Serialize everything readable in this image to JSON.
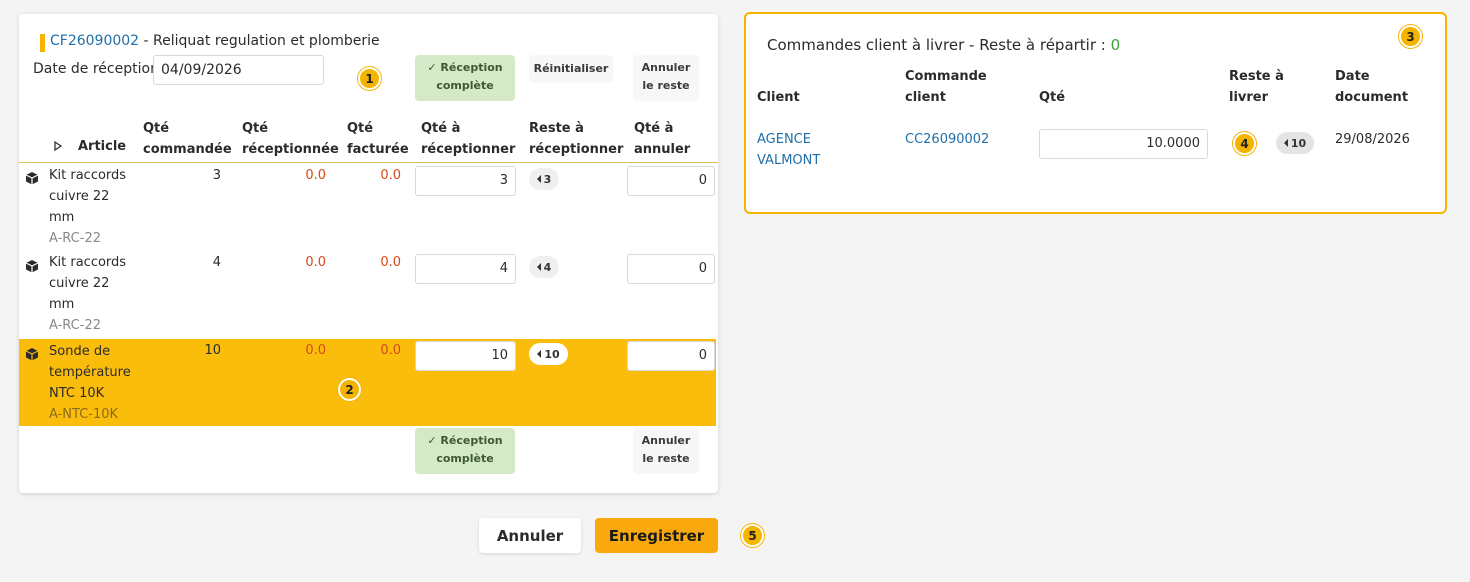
{
  "order": {
    "ref": "CF26090002",
    "separator": " - ",
    "description": "Reliquat regulation et plomberie"
  },
  "reception_date": {
    "label": "Date de réception",
    "value": "04/09/2026"
  },
  "toolbar": {
    "complete_label_1": "Réception",
    "complete_label_2": "complète",
    "reset_label": "Réinitialiser",
    "cancel_rest_1": "Annuler",
    "cancel_rest_2": "le reste"
  },
  "table": {
    "headers": {
      "article": "Article",
      "qty_ordered_1": "Qté",
      "qty_ordered_2": "commandée",
      "qty_received_1": "Qté",
      "qty_received_2": "réceptionnée",
      "qty_invoiced_1": "Qté",
      "qty_invoiced_2": "facturée",
      "qty_to_receive_1": "Qté à",
      "qty_to_receive_2": "réceptionner",
      "remaining_1": "Reste à",
      "remaining_2": "réceptionner",
      "qty_to_cancel_1": "Qté à",
      "qty_to_cancel_2": "annuler"
    },
    "rows": [
      {
        "name_1": "Kit raccords",
        "name_2": "cuivre 22",
        "name_3": "mm",
        "code": "A-RC-22",
        "ordered": "3",
        "received": "0.0",
        "invoiced": "0.0",
        "to_receive": "3",
        "remaining": "3",
        "to_cancel": "0"
      },
      {
        "name_1": "Kit raccords",
        "name_2": "cuivre 22",
        "name_3": "mm",
        "code": "A-RC-22",
        "ordered": "4",
        "received": "0.0",
        "invoiced": "0.0",
        "to_receive": "4",
        "remaining": "4",
        "to_cancel": "0"
      },
      {
        "name_1": "Sonde de",
        "name_2": "température",
        "name_3": "NTC 10K",
        "code": "A-NTC-10K",
        "ordered": "10",
        "received": "0.0",
        "invoiced": "0.0",
        "to_receive": "10",
        "remaining": "10",
        "to_cancel": "0"
      }
    ]
  },
  "badges": [
    "1",
    "2",
    "3",
    "4",
    "5"
  ],
  "right_panel": {
    "title": "Commandes client à livrer - Reste à répartir : ",
    "remaining_value": "0",
    "headers": {
      "client": "Client",
      "order_1": "Commande",
      "order_2": "client",
      "qty": "Qté",
      "remaining_1": "Reste à",
      "remaining_2": "livrer",
      "date_1": "Date",
      "date_2": "document"
    },
    "row": {
      "client_1": "AGENCE",
      "client_2": "VALMONT",
      "order": "CC26090002",
      "qty": "10.0000",
      "remaining": "10",
      "date": "29/08/2026"
    }
  },
  "footer": {
    "cancel_label": "Annuler",
    "save_label": "Enregistrer"
  },
  "colors": {
    "accent": "#f5b400",
    "highlight_row": "#fbbd0c",
    "link": "#1f6fa8",
    "received_red": "#d44a1a",
    "remaining_green": "#3aa335",
    "complete_btn_bg": "#d5e8c8"
  }
}
